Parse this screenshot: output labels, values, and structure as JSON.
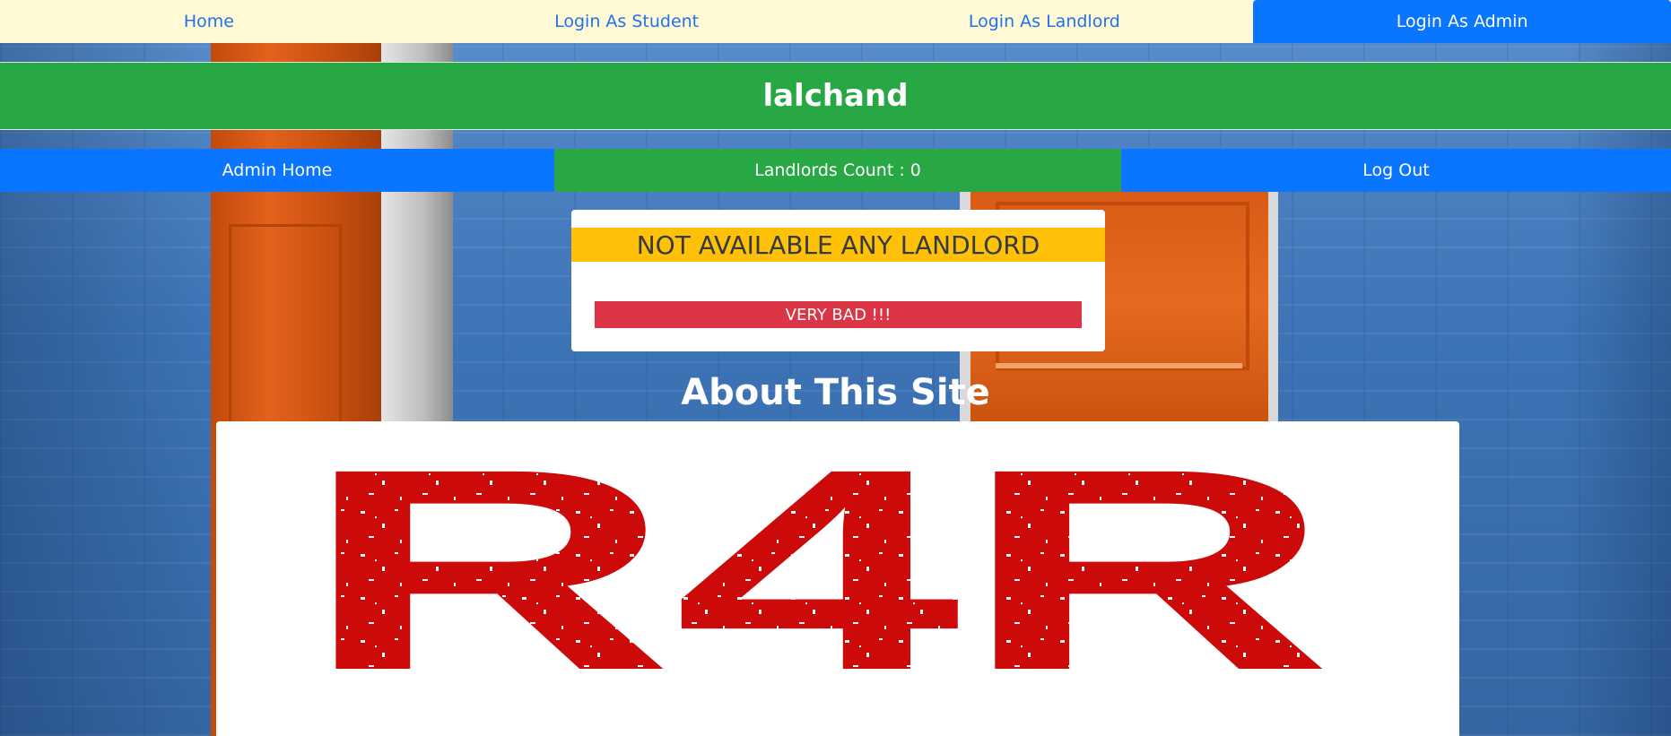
{
  "nav": {
    "items": [
      "Home",
      "Login As Student",
      "Login As Landlord",
      "Login As Admin"
    ],
    "active_item": "Login As Admin"
  },
  "header": {
    "title": "lalchand"
  },
  "admin_bar": {
    "home_label": "Admin Home",
    "count_label": "Landlords Count : 0",
    "logout_label": "Log Out"
  },
  "notice": {
    "warning": "NOT AVAILABLE ANY LANDLORD",
    "status": "VERY BAD !!!"
  },
  "about": {
    "heading": "About This Site",
    "logo_text": "R4R"
  },
  "colors": {
    "nav_background": "#fff9d6",
    "primary": "#0a75ff",
    "success": "#28a745",
    "warning": "#ffc107",
    "danger": "#dc3545",
    "logo_red": "#cc0a0a"
  }
}
